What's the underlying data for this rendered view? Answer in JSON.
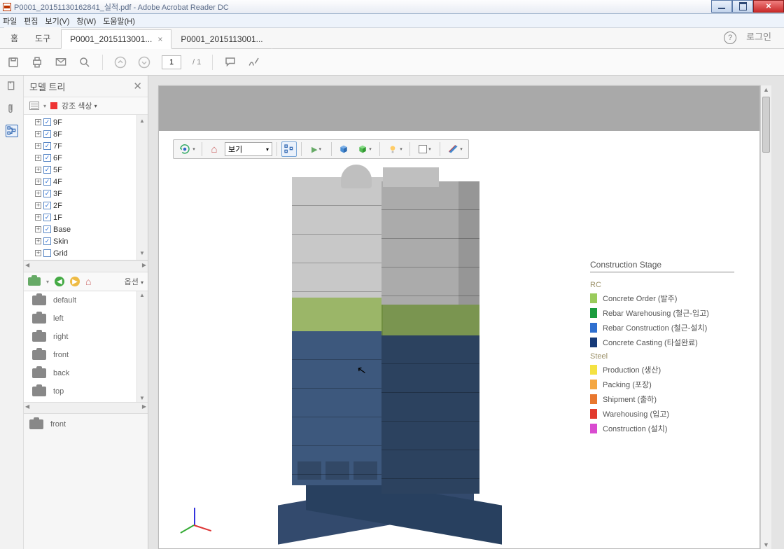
{
  "window": {
    "title": "P0001_20151130162841_실적.pdf - Adobe Acrobat Reader DC"
  },
  "menu": [
    "파일",
    "편집",
    "보기(V)",
    "창(W)",
    "도움말(H)"
  ],
  "toptabs": {
    "home": "홈",
    "tools": "도구"
  },
  "doctabs": [
    {
      "label": "P0001_2015113001...",
      "active": true
    },
    {
      "label": "P0001_2015113001...",
      "active": false
    }
  ],
  "login": "로그인",
  "pageNav": {
    "current": "1",
    "total": "/ 1"
  },
  "modeltree": {
    "title": "모델 트리",
    "highlight": "강조 색상",
    "items": [
      {
        "label": "9F",
        "checked": true
      },
      {
        "label": "8F",
        "checked": true
      },
      {
        "label": "7F",
        "checked": true
      },
      {
        "label": "6F",
        "checked": true
      },
      {
        "label": "5F",
        "checked": true
      },
      {
        "label": "4F",
        "checked": true
      },
      {
        "label": "3F",
        "checked": true
      },
      {
        "label": "2F",
        "checked": true
      },
      {
        "label": "1F",
        "checked": true
      },
      {
        "label": "Base",
        "checked": true
      },
      {
        "label": "Skin",
        "checked": true
      },
      {
        "label": "Grid",
        "checked": false
      }
    ]
  },
  "viewbar": {
    "options": "옵션"
  },
  "views": [
    "default",
    "left",
    "right",
    "front",
    "back",
    "top"
  ],
  "currentView": "front",
  "toolbar3d": {
    "viewSelect": "보기"
  },
  "legend": {
    "title": "Construction Stage",
    "groups": [
      {
        "name": "RC",
        "items": [
          {
            "color": "#9acb5c",
            "label": "Concrete Order (발주)"
          },
          {
            "color": "#1a9c3e",
            "label": "Rebar Warehousing (철근-입고)"
          },
          {
            "color": "#2f6fcf",
            "label": "Rebar Construction (철근-설치)"
          },
          {
            "color": "#163a78",
            "label": "Concrete Casting (타설완료)"
          }
        ]
      },
      {
        "name": "Steel",
        "items": [
          {
            "color": "#f4e242",
            "label": "Production (생산)"
          },
          {
            "color": "#f4a742",
            "label": "Packing (포장)"
          },
          {
            "color": "#e8772e",
            "label": "Shipment (출하)"
          },
          {
            "color": "#e23b2e",
            "label": "Warehousing (입고)"
          },
          {
            "color": "#d94bd0",
            "label": "Construction (설치)"
          }
        ]
      }
    ]
  }
}
